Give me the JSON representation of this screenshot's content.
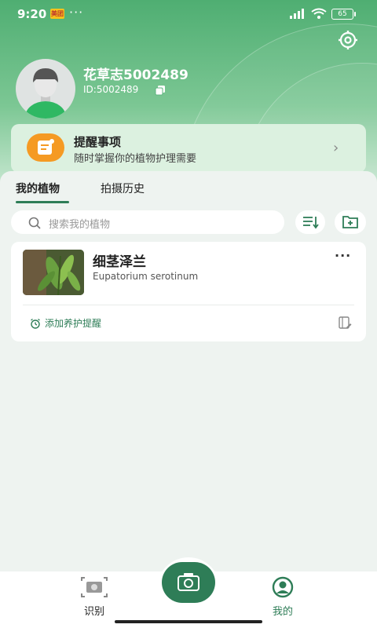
{
  "status_bar": {
    "time": "9:20",
    "app_badge": "美团",
    "dots": "···",
    "battery": "65"
  },
  "profile": {
    "username": "花草志5002489",
    "user_id": "ID:5002489"
  },
  "reminder": {
    "title": "提醒事项",
    "subtitle": "随时掌握你的植物护理需要",
    "chevron": "›"
  },
  "tabs": [
    {
      "label": "我的植物"
    },
    {
      "label": "拍摄历史"
    }
  ],
  "search": {
    "placeholder": "搜索我的植物"
  },
  "plants": [
    {
      "name": "细茎泽兰",
      "latin": "Eupatorium serotinum",
      "more": "···",
      "add_reminder": "添加养护提醒"
    }
  ],
  "bottom_nav": {
    "identify": "识别",
    "mine": "我的"
  },
  "colors": {
    "primary": "#2e7d57",
    "accent_orange": "#f59a23",
    "header_green": "#4fae72"
  }
}
